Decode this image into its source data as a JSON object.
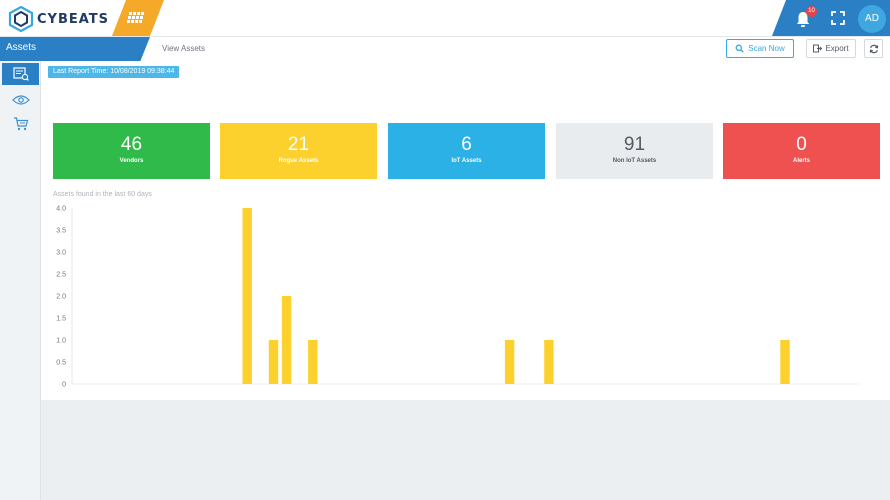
{
  "app": {
    "logo_text": "CYBEATS"
  },
  "header": {
    "notification_count": "10",
    "user_initials": "AD"
  },
  "subbar": {
    "section": "Assets",
    "breadcrumb": "View Assets",
    "scan_label": "Scan Now",
    "export_label": "Export"
  },
  "sidebar": {
    "items": [
      "view-assets",
      "devices",
      "network-scan"
    ]
  },
  "report": {
    "time": "Last Report Time: 10/08/2019 09:38:44"
  },
  "cards": [
    {
      "value": "46",
      "label": "Vendors",
      "color": "#2fba4a"
    },
    {
      "value": "21",
      "label": "Rogue Assets",
      "color": "#fcd12e"
    },
    {
      "value": "6",
      "label": "IoT Assets",
      "color": "#2bb1e6"
    },
    {
      "value": "91",
      "label": "Non IoT Assets",
      "color": "#e9ecef"
    },
    {
      "value": "0",
      "label": "Alerts",
      "color": "#ef5050"
    }
  ],
  "colors": {
    "brand_blue": "#2b7fc5",
    "accent_orange": "#f4a928",
    "bar_yellow": "#fcd12e"
  },
  "chart_data": {
    "type": "bar",
    "title": "Assets found in the last 60 days",
    "xlabel": "",
    "ylabel": "",
    "ylim": [
      0,
      4
    ],
    "yticks": [
      "0",
      "0.5",
      "1.0",
      "1.5",
      "2.0",
      "2.5",
      "3.0",
      "3.5",
      "4.0"
    ],
    "x_count": 60,
    "bars": [
      {
        "x": 13,
        "value": 4
      },
      {
        "x": 15,
        "value": 1
      },
      {
        "x": 16,
        "value": 2
      },
      {
        "x": 18,
        "value": 1
      },
      {
        "x": 33,
        "value": 1
      },
      {
        "x": 36,
        "value": 1
      },
      {
        "x": 54,
        "value": 1
      }
    ]
  }
}
